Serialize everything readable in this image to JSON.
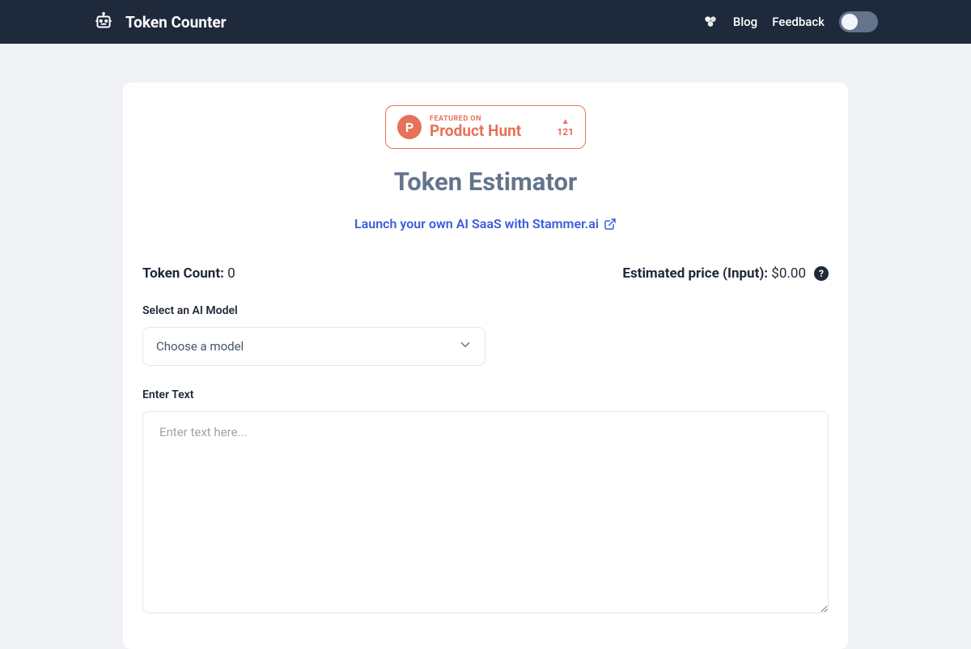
{
  "header": {
    "app_title": "Token Counter",
    "nav": {
      "blog": "Blog",
      "feedback": "Feedback"
    }
  },
  "product_hunt": {
    "logo_letter": "P",
    "featured_text": "FEATURED ON",
    "name": "Product Hunt",
    "votes": "121"
  },
  "main": {
    "title": "Token Estimator",
    "launch_link": "Launch your own AI SaaS with Stammer.ai"
  },
  "stats": {
    "token_count_label": "Token Count:",
    "token_count_value": "0",
    "price_label": "Estimated price (Input):",
    "price_value": "$0.00",
    "help_symbol": "?"
  },
  "form": {
    "model_label": "Select an AI Model",
    "model_placeholder": "Choose a model",
    "text_label": "Enter Text",
    "text_placeholder": "Enter text here..."
  }
}
